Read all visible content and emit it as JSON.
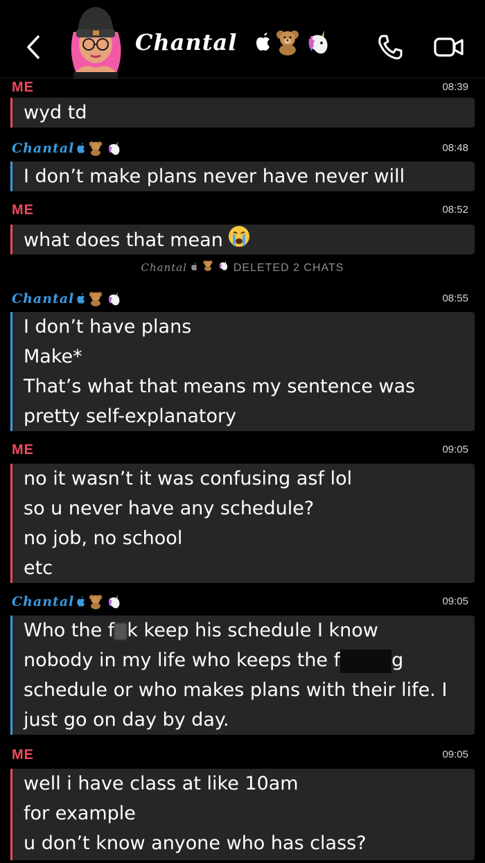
{
  "header": {
    "contact_name": "Chantal",
    "emojis": [
      "apple-icon",
      "teddy-bear-icon",
      "unicorn-icon"
    ]
  },
  "colors": {
    "me": "#ef4a5c",
    "her": "#3b9ae0",
    "bubble": "#262626"
  },
  "messages": [
    {
      "sender": "ME",
      "time": "08:39",
      "lines": [
        "wyd td"
      ]
    },
    {
      "sender": "Chantal",
      "time": "08:48",
      "lines": [
        "I don’t make plans never have never will"
      ]
    },
    {
      "sender": "ME",
      "time": "08:52",
      "lines": [
        "what does that mean"
      ]
    },
    {
      "sender": "Chantal",
      "time": "08:55",
      "lines": [
        "I don’t have plans",
        "Make*",
        "That’s what that means my sentence was",
        "pretty self-explanatory"
      ]
    },
    {
      "sender": "ME",
      "time": "09:05",
      "lines": [
        "no it wasn’t it was confusing asf lol",
        "so u never have any schedule?",
        "no job, no school",
        "etc"
      ]
    },
    {
      "sender": "Chantal",
      "time": "09:05",
      "lines": [
        "Who the f",
        "k keep his schedule I know",
        "nobody in my life who keeps the f",
        "g",
        "schedule or who makes plans with their life. I",
        "just go on day by day."
      ]
    },
    {
      "sender": "ME",
      "time": "09:05",
      "lines": [
        "well i have class at like 10am",
        "for example",
        "u don’t know anyone who has class?"
      ]
    }
  ],
  "deleted_notice": {
    "name": "Chantal",
    "text": "DELETED 2 CHATS"
  }
}
